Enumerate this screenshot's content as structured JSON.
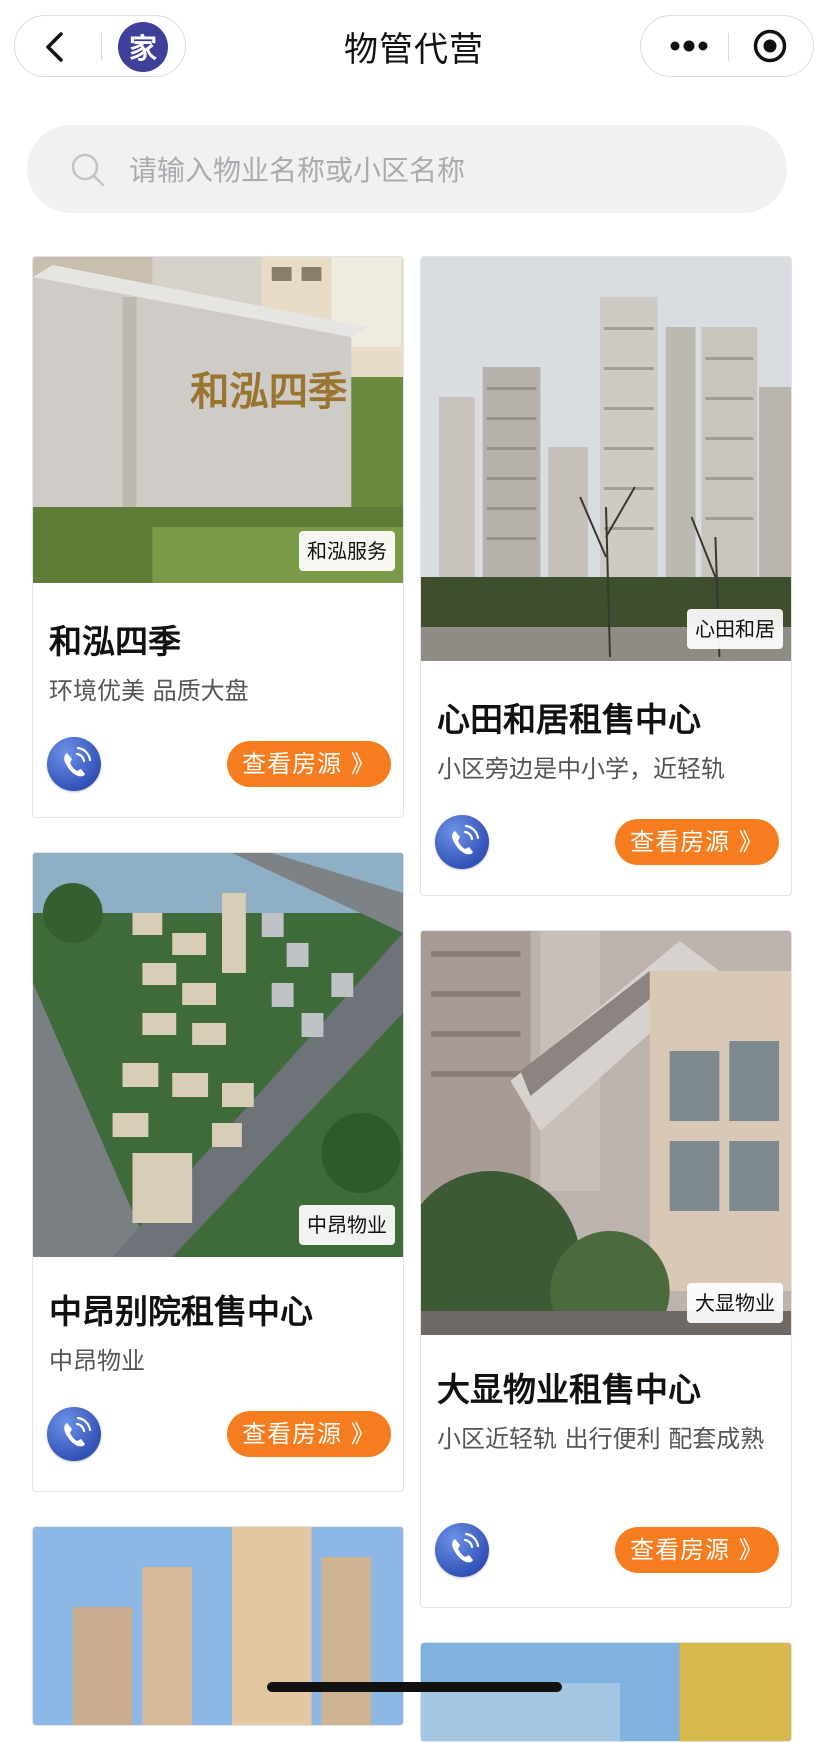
{
  "nav": {
    "title": "物管代营",
    "logo_text": "家"
  },
  "search": {
    "placeholder": "请输入物业名称或小区名称"
  },
  "cards": [
    {
      "badge": "和泓服务",
      "title": "和泓四季",
      "desc": "环境优美 品质大盘",
      "button": "查看房源 》",
      "sign_text": "和泓四季"
    },
    {
      "badge": "心田和居",
      "title": "心田和居租售中心",
      "desc": "小区旁边是中小学，近轻轨",
      "button": "查看房源 》"
    },
    {
      "badge": "中昂物业",
      "title": "中昂别院租售中心",
      "desc": "中昂物业",
      "button": "查看房源 》"
    },
    {
      "badge": "大显物业",
      "title": "大显物业租售中心",
      "desc": "小区近轻轨 出行便利 配套成熟",
      "button": "查看房源 》"
    }
  ],
  "icons": {
    "back": "back-chevron-icon",
    "more": "more-dots-icon",
    "close": "target-circle-icon",
    "search": "search-icon",
    "phone": "phone-icon"
  },
  "colors": {
    "accent": "#f57c1f",
    "phone_button": "#3353b8",
    "search_bg": "#f1f1f2"
  }
}
